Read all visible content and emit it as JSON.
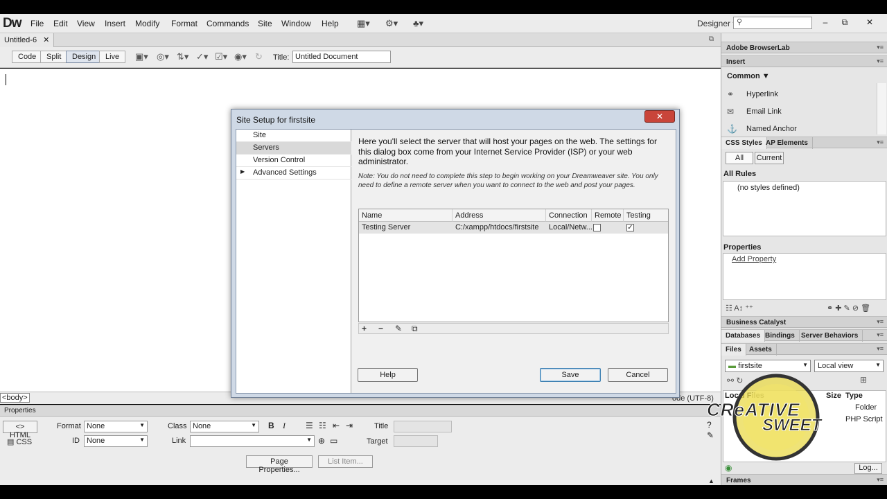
{
  "app": {
    "logo": "Dw",
    "menus": [
      "File",
      "Edit",
      "View",
      "Insert",
      "Modify",
      "Format",
      "Commands",
      "Site",
      "Window",
      "Help"
    ],
    "workspace": "Designer",
    "window_controls": [
      "–",
      "⧉",
      "✕"
    ]
  },
  "document": {
    "tab_label": "Untitled-6",
    "tab_close": "✕",
    "view_buttons": [
      "Code",
      "Split",
      "Design",
      "Live"
    ],
    "active_view": "Design",
    "title_label": "Title:",
    "title_value": "Untitled Document",
    "tag_selector": "<body>",
    "encoding": "ode (UTF-8)"
  },
  "properties": {
    "header": "Properties",
    "html_btn": "HTML",
    "css_btn": "CSS",
    "format_label": "Format",
    "format_value": "None",
    "class_label": "Class",
    "class_value": "None",
    "id_label": "ID",
    "id_value": "None",
    "link_label": "Link",
    "title_label": "Title",
    "target_label": "Target",
    "page_properties_btn": "Page Properties...",
    "list_item_btn": "List Item..."
  },
  "right_panel": {
    "browserlab": "Adobe BrowserLab",
    "insert": "Insert",
    "insert_category": "Common",
    "insert_items": [
      "Hyperlink",
      "Email Link",
      "Named Anchor"
    ],
    "css_tabs": [
      "CSS Styles",
      "AP Elements"
    ],
    "css_mode_buttons": [
      "All",
      "Current"
    ],
    "all_rules_label": "All Rules",
    "no_styles": "(no styles defined)",
    "properties_label": "Properties",
    "add_property": "Add Property",
    "business_catalyst": "Business Catalyst",
    "data_tabs": [
      "Databases",
      "Bindings",
      "Server Behaviors"
    ],
    "files_tabs": [
      "Files",
      "Assets"
    ],
    "site_select": "firstsite",
    "view_select": "Local view",
    "files_columns": [
      "Local Files",
      "Size",
      "Type"
    ],
    "files_rows": [
      {
        "type": "Folder"
      },
      {
        "type": "PHP Script"
      }
    ],
    "log_btn": "Log...",
    "frames": "Frames"
  },
  "dialog": {
    "title": "Site Setup for firstsite",
    "close": "✕",
    "categories": [
      "Site",
      "Servers",
      "Version Control",
      "Advanced Settings"
    ],
    "selected_category": "Servers",
    "description": "Here you'll select the server that will host your pages on the web. The settings for this dialog box come from your Internet Service Provider (ISP) or your web administrator.",
    "note": "Note: You do not need to complete this step to begin working on your Dreamweaver site. You only need to define a remote server when you want to connect to the web and post your pages.",
    "table_headers": [
      "Name",
      "Address",
      "Connection",
      "Remote",
      "Testing"
    ],
    "servers": [
      {
        "name": "Testing Server",
        "address": "C:/xampp/htdocs/firstsite",
        "connection": "Local/Netw...",
        "remote": false,
        "testing": true
      }
    ],
    "table_tools": [
      "+",
      "−",
      "✎",
      "⧉"
    ],
    "help_btn": "Help",
    "save_btn": "Save",
    "cancel_btn": "Cancel"
  },
  "watermark": {
    "line1": "CReATIVE",
    "line2": "SWEET"
  }
}
